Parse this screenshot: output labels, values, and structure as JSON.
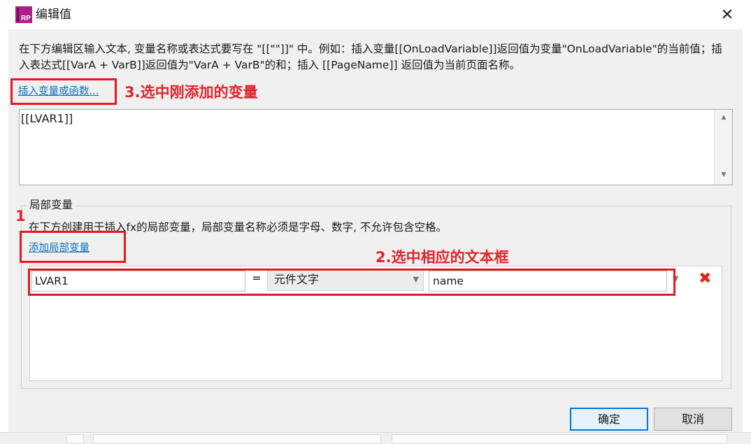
{
  "window": {
    "title": "编辑值",
    "app_icon_label": "RP",
    "close_glyph": "✕"
  },
  "instructions": "在下方编辑区输入文本, 变量名称或表达式要写在 \"[[\"\"]]\" 中。例如：插入变量[[OnLoadVariable]]返回值为变量\"OnLoadVariable\"的当前值；插入表达式[[VarA + VarB]]返回值为\"VarA + VarB\"的和；插入 [[PageName]] 返回值为当前页面名称。",
  "insert_link": "插入变量或函数...",
  "editor": {
    "value": "[[LVAR1]]"
  },
  "local_vars": {
    "legend": "局部变量",
    "description": "在下方创建用于插入fx的局部变量，局部变量名称必须是字母、数字, 不允许包含空格。",
    "add_link": "添加局部变量",
    "rows": [
      {
        "name": "LVAR1",
        "equals": "=",
        "type": "元件文字",
        "value": "name"
      }
    ]
  },
  "buttons": {
    "ok": "确定",
    "cancel": "取消"
  },
  "annotations": {
    "step1": "1",
    "step2": "2.选中相应的文本框",
    "step3": "3.选中刚添加的变量"
  },
  "colors": {
    "annotation_red": "#e8171e",
    "link_blue": "#0d6fb8",
    "delete_red": "#e0271c",
    "icon_magenta": "#b01e8c"
  }
}
